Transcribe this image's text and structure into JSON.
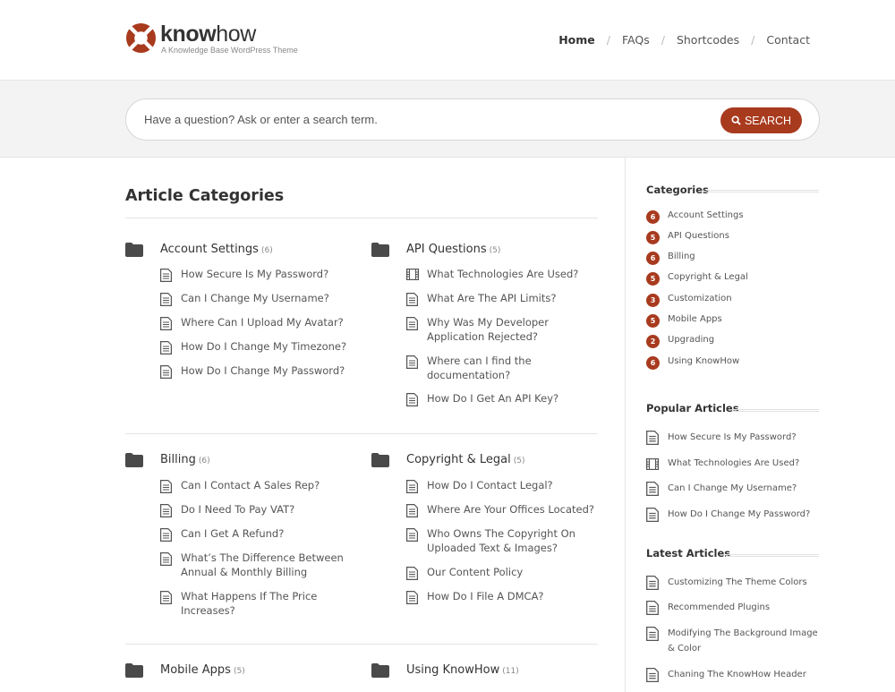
{
  "brand": {
    "name_bold": "know",
    "name_light": "how",
    "tagline": "A Knowledge Base WordPress Theme",
    "accent": "#a83a1e"
  },
  "nav": {
    "items": [
      {
        "label": "Home"
      },
      {
        "label": "FAQs"
      },
      {
        "label": "Shortcodes"
      },
      {
        "label": "Contact"
      }
    ],
    "separator": "/"
  },
  "search": {
    "placeholder": "Have a question? Ask or enter a search term.",
    "button_label": "SEARCH"
  },
  "main": {
    "title": "Article Categories",
    "categories": [
      {
        "name": "Account Settings",
        "count": "(6)",
        "articles": [
          {
            "title": "How Secure Is My Password?",
            "icon": "document-icon"
          },
          {
            "title": "Can I Change My Username?",
            "icon": "document-icon"
          },
          {
            "title": "Where Can I Upload My Avatar?",
            "icon": "document-icon"
          },
          {
            "title": "How Do I Change My Timezone?",
            "icon": "document-icon"
          },
          {
            "title": "How Do I Change My Password?",
            "icon": "document-icon"
          }
        ]
      },
      {
        "name": "API Questions",
        "count": "(5)",
        "articles": [
          {
            "title": "What Technologies Are Used?",
            "icon": "film-icon"
          },
          {
            "title": "What Are The API Limits?",
            "icon": "document-icon"
          },
          {
            "title": "Why Was My Developer Application Rejected?",
            "icon": "document-icon"
          },
          {
            "title": "Where can I find the documentation?",
            "icon": "document-icon"
          },
          {
            "title": "How Do I Get An API Key?",
            "icon": "document-icon"
          }
        ]
      },
      {
        "name": "Billing",
        "count": "(6)",
        "articles": [
          {
            "title": "Can I Contact A Sales Rep?",
            "icon": "document-icon"
          },
          {
            "title": "Do I Need To Pay VAT?",
            "icon": "document-icon"
          },
          {
            "title": "Can I Get A Refund?",
            "icon": "document-icon"
          },
          {
            "title": "What’s The Difference Between Annual & Monthly Billing",
            "icon": "document-icon"
          },
          {
            "title": "What Happens If The Price Increases?",
            "icon": "document-icon"
          }
        ]
      },
      {
        "name": "Copyright & Legal",
        "count": "(5)",
        "articles": [
          {
            "title": "How Do I Contact Legal?",
            "icon": "document-icon"
          },
          {
            "title": "Where Are Your Offices Located?",
            "icon": "document-icon"
          },
          {
            "title": "Who Owns The Copyright On Uploaded Text & Images?",
            "icon": "document-icon"
          },
          {
            "title": "Our Content Policy",
            "icon": "document-icon"
          },
          {
            "title": "How Do I File A DMCA?",
            "icon": "document-icon"
          }
        ]
      },
      {
        "name": "Mobile Apps",
        "count": "(5)",
        "articles": []
      },
      {
        "name": "Using KnowHow",
        "count": "(11)",
        "articles": []
      }
    ]
  },
  "sidebar": {
    "categories_title": "Categories",
    "categories": [
      {
        "count": "6",
        "name": "Account Settings"
      },
      {
        "count": "5",
        "name": "API Questions"
      },
      {
        "count": "6",
        "name": "Billing"
      },
      {
        "count": "5",
        "name": "Copyright & Legal"
      },
      {
        "count": "3",
        "name": "Customization"
      },
      {
        "count": "5",
        "name": "Mobile Apps"
      },
      {
        "count": "2",
        "name": "Upgrading"
      },
      {
        "count": "6",
        "name": "Using KnowHow"
      }
    ],
    "popular_title": "Popular Articles",
    "popular": [
      {
        "title": "How Secure Is My Password?",
        "icon": "document-icon"
      },
      {
        "title": "What Technologies Are Used?",
        "icon": "film-icon"
      },
      {
        "title": "Can I Change My Username?",
        "icon": "document-icon"
      },
      {
        "title": "How Do I Change My Password?",
        "icon": "document-icon"
      }
    ],
    "latest_title": "Latest Articles",
    "latest": [
      {
        "title": "Customizing The Theme Colors",
        "icon": "document-icon"
      },
      {
        "title": "Recommended Plugins",
        "icon": "document-icon"
      },
      {
        "title": "Modifying The Background Image & Color",
        "icon": "document-icon"
      },
      {
        "title": "Chaning The KnowHow Header",
        "icon": "document-icon"
      }
    ]
  }
}
